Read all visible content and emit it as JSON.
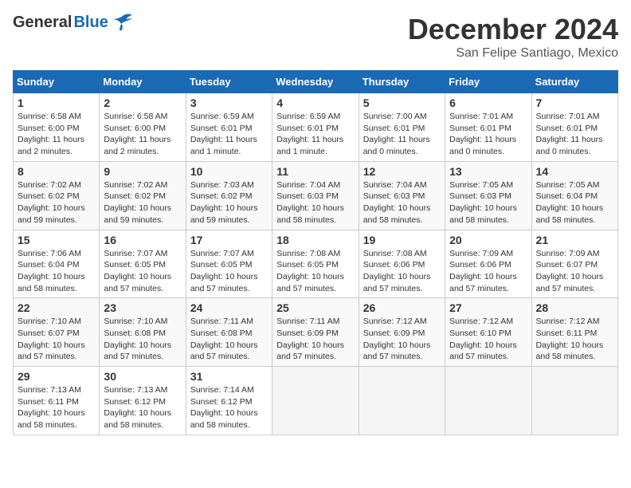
{
  "header": {
    "logo_general": "General",
    "logo_blue": "Blue",
    "month": "December 2024",
    "location": "San Felipe Santiago, Mexico"
  },
  "days_of_week": [
    "Sunday",
    "Monday",
    "Tuesday",
    "Wednesday",
    "Thursday",
    "Friday",
    "Saturday"
  ],
  "weeks": [
    [
      {
        "day": 1,
        "info": "Sunrise: 6:58 AM\nSunset: 6:00 PM\nDaylight: 11 hours\nand 2 minutes."
      },
      {
        "day": 2,
        "info": "Sunrise: 6:58 AM\nSunset: 6:00 PM\nDaylight: 11 hours\nand 2 minutes."
      },
      {
        "day": 3,
        "info": "Sunrise: 6:59 AM\nSunset: 6:01 PM\nDaylight: 11 hours\nand 1 minute."
      },
      {
        "day": 4,
        "info": "Sunrise: 6:59 AM\nSunset: 6:01 PM\nDaylight: 11 hours\nand 1 minute."
      },
      {
        "day": 5,
        "info": "Sunrise: 7:00 AM\nSunset: 6:01 PM\nDaylight: 11 hours\nand 0 minutes."
      },
      {
        "day": 6,
        "info": "Sunrise: 7:01 AM\nSunset: 6:01 PM\nDaylight: 11 hours\nand 0 minutes."
      },
      {
        "day": 7,
        "info": "Sunrise: 7:01 AM\nSunset: 6:01 PM\nDaylight: 11 hours\nand 0 minutes."
      }
    ],
    [
      {
        "day": 8,
        "info": "Sunrise: 7:02 AM\nSunset: 6:02 PM\nDaylight: 10 hours\nand 59 minutes."
      },
      {
        "day": 9,
        "info": "Sunrise: 7:02 AM\nSunset: 6:02 PM\nDaylight: 10 hours\nand 59 minutes."
      },
      {
        "day": 10,
        "info": "Sunrise: 7:03 AM\nSunset: 6:02 PM\nDaylight: 10 hours\nand 59 minutes."
      },
      {
        "day": 11,
        "info": "Sunrise: 7:04 AM\nSunset: 6:03 PM\nDaylight: 10 hours\nand 58 minutes."
      },
      {
        "day": 12,
        "info": "Sunrise: 7:04 AM\nSunset: 6:03 PM\nDaylight: 10 hours\nand 58 minutes."
      },
      {
        "day": 13,
        "info": "Sunrise: 7:05 AM\nSunset: 6:03 PM\nDaylight: 10 hours\nand 58 minutes."
      },
      {
        "day": 14,
        "info": "Sunrise: 7:05 AM\nSunset: 6:04 PM\nDaylight: 10 hours\nand 58 minutes."
      }
    ],
    [
      {
        "day": 15,
        "info": "Sunrise: 7:06 AM\nSunset: 6:04 PM\nDaylight: 10 hours\nand 58 minutes."
      },
      {
        "day": 16,
        "info": "Sunrise: 7:07 AM\nSunset: 6:05 PM\nDaylight: 10 hours\nand 57 minutes."
      },
      {
        "day": 17,
        "info": "Sunrise: 7:07 AM\nSunset: 6:05 PM\nDaylight: 10 hours\nand 57 minutes."
      },
      {
        "day": 18,
        "info": "Sunrise: 7:08 AM\nSunset: 6:05 PM\nDaylight: 10 hours\nand 57 minutes."
      },
      {
        "day": 19,
        "info": "Sunrise: 7:08 AM\nSunset: 6:06 PM\nDaylight: 10 hours\nand 57 minutes."
      },
      {
        "day": 20,
        "info": "Sunrise: 7:09 AM\nSunset: 6:06 PM\nDaylight: 10 hours\nand 57 minutes."
      },
      {
        "day": 21,
        "info": "Sunrise: 7:09 AM\nSunset: 6:07 PM\nDaylight: 10 hours\nand 57 minutes."
      }
    ],
    [
      {
        "day": 22,
        "info": "Sunrise: 7:10 AM\nSunset: 6:07 PM\nDaylight: 10 hours\nand 57 minutes."
      },
      {
        "day": 23,
        "info": "Sunrise: 7:10 AM\nSunset: 6:08 PM\nDaylight: 10 hours\nand 57 minutes."
      },
      {
        "day": 24,
        "info": "Sunrise: 7:11 AM\nSunset: 6:08 PM\nDaylight: 10 hours\nand 57 minutes."
      },
      {
        "day": 25,
        "info": "Sunrise: 7:11 AM\nSunset: 6:09 PM\nDaylight: 10 hours\nand 57 minutes."
      },
      {
        "day": 26,
        "info": "Sunrise: 7:12 AM\nSunset: 6:09 PM\nDaylight: 10 hours\nand 57 minutes."
      },
      {
        "day": 27,
        "info": "Sunrise: 7:12 AM\nSunset: 6:10 PM\nDaylight: 10 hours\nand 57 minutes."
      },
      {
        "day": 28,
        "info": "Sunrise: 7:12 AM\nSunset: 6:11 PM\nDaylight: 10 hours\nand 58 minutes."
      }
    ],
    [
      {
        "day": 29,
        "info": "Sunrise: 7:13 AM\nSunset: 6:11 PM\nDaylight: 10 hours\nand 58 minutes."
      },
      {
        "day": 30,
        "info": "Sunrise: 7:13 AM\nSunset: 6:12 PM\nDaylight: 10 hours\nand 58 minutes."
      },
      {
        "day": 31,
        "info": "Sunrise: 7:14 AM\nSunset: 6:12 PM\nDaylight: 10 hours\nand 58 minutes."
      },
      null,
      null,
      null,
      null
    ]
  ]
}
